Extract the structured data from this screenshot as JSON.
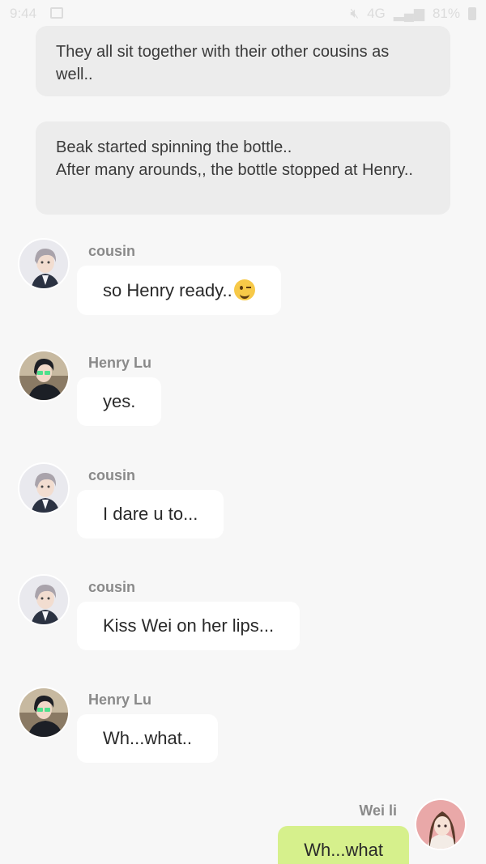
{
  "status_bar": {
    "time": "9:44",
    "battery": "81%",
    "network": "4G"
  },
  "narrations": [
    {
      "text": "They all sit together with their other cousins as well.."
    },
    {
      "text": "Beak started spinning the bottle..\nAfter many arounds,, the bottle stopped at Henry.."
    }
  ],
  "messages": [
    {
      "sender": "cousin",
      "text": "so Henry ready..",
      "avatar": "cousin-avatar",
      "emoji": "wink"
    },
    {
      "sender": "Henry Lu",
      "text": "yes.",
      "avatar": "henry-avatar"
    },
    {
      "sender": "cousin",
      "text": "I dare u to...",
      "avatar": "cousin-avatar"
    },
    {
      "sender": "cousin",
      "text": "Kiss Wei on her lips...",
      "avatar": "cousin-avatar"
    },
    {
      "sender": "Henry Lu",
      "text": "Wh...what..",
      "avatar": "henry-avatar"
    },
    {
      "sender": "Wei li",
      "text": "Wh...what",
      "avatar": "wei-avatar"
    }
  ],
  "colors": {
    "background": "#f7f7f7",
    "narration_bg": "#ececec",
    "bubble_bg": "#ffffff",
    "my_bubble_bg": "#d6f08c",
    "sender_name": "#8a8a8a"
  }
}
